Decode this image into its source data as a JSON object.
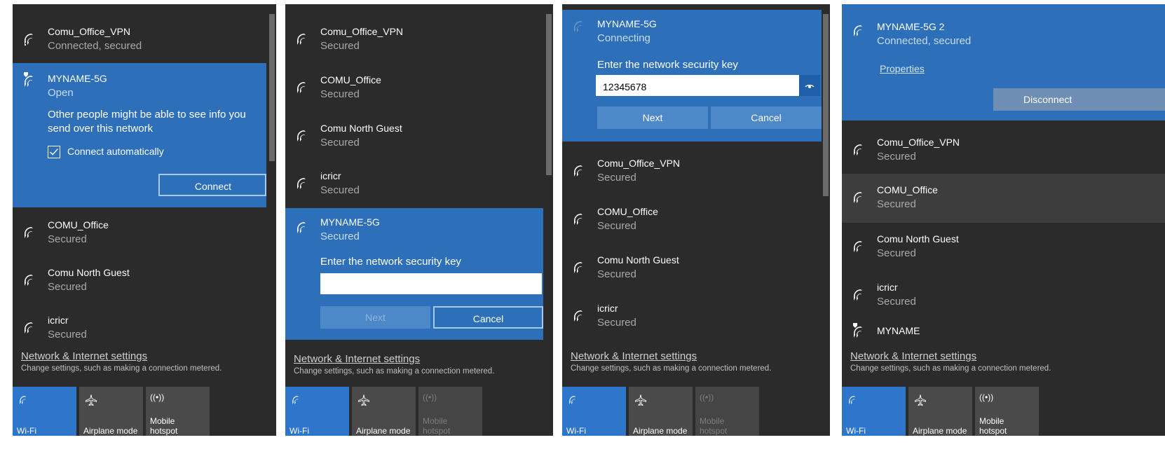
{
  "common": {
    "settings_link": "Network & Internet settings",
    "settings_desc": "Change settings, such as making a connection metered.",
    "qa_wifi": "Wi-Fi",
    "qa_airplane": "Airplane mode",
    "qa_hotspot_line1": "Mobile",
    "qa_hotspot_line2": "hotspot",
    "hotspot_icon": "((•))"
  },
  "panel1": {
    "networks": [
      {
        "name": "Comu_Office_VPN",
        "status": "Connected, secured"
      },
      {
        "name": "COMU_Office",
        "status": "Secured"
      },
      {
        "name": "Comu North Guest",
        "status": "Secured"
      },
      {
        "name": "icricr",
        "status": "Secured"
      }
    ],
    "selected": {
      "name": "MYNAME-5G",
      "status": "Open",
      "warning": "Other people might be able to see info you send over this network",
      "checkbox_label": "Connect automatically",
      "checkbox_checked": true,
      "button": "Connect"
    }
  },
  "panel2": {
    "networks": [
      {
        "name": "Comu_Office_VPN",
        "status": "Secured"
      },
      {
        "name": "COMU_Office",
        "status": "Secured"
      },
      {
        "name": "Comu North Guest",
        "status": "Secured"
      },
      {
        "name": "icricr",
        "status": "Secured"
      }
    ],
    "selected": {
      "name": "MYNAME-5G",
      "status": "Secured",
      "key_prompt": "Enter the network security key",
      "key_value": "",
      "next": "Next",
      "cancel": "Cancel"
    }
  },
  "panel3": {
    "selected": {
      "name": "MYNAME-5G",
      "status": "Connecting",
      "key_prompt": "Enter the network security key",
      "key_value": "12345678",
      "next": "Next",
      "cancel": "Cancel"
    },
    "networks": [
      {
        "name": "Comu_Office_VPN",
        "status": "Secured"
      },
      {
        "name": "COMU_Office",
        "status": "Secured"
      },
      {
        "name": "Comu North Guest",
        "status": "Secured"
      },
      {
        "name": "icricr",
        "status": "Secured"
      }
    ]
  },
  "panel4": {
    "selected": {
      "name": "MYNAME-5G 2",
      "status": "Connected, secured",
      "properties": "Properties",
      "disconnect": "Disconnect"
    },
    "networks": [
      {
        "name": "Comu_Office_VPN",
        "status": "Secured"
      },
      {
        "name": "COMU_Office",
        "status": "Secured"
      },
      {
        "name": "Comu North Guest",
        "status": "Secured"
      },
      {
        "name": "icricr",
        "status": "Secured"
      }
    ],
    "open_network": {
      "name": "MYNAME"
    }
  },
  "colors": {
    "accent": "#2d6fb8",
    "panel_bg": "#2b2b2b",
    "tile_on": "#2d76cc"
  }
}
